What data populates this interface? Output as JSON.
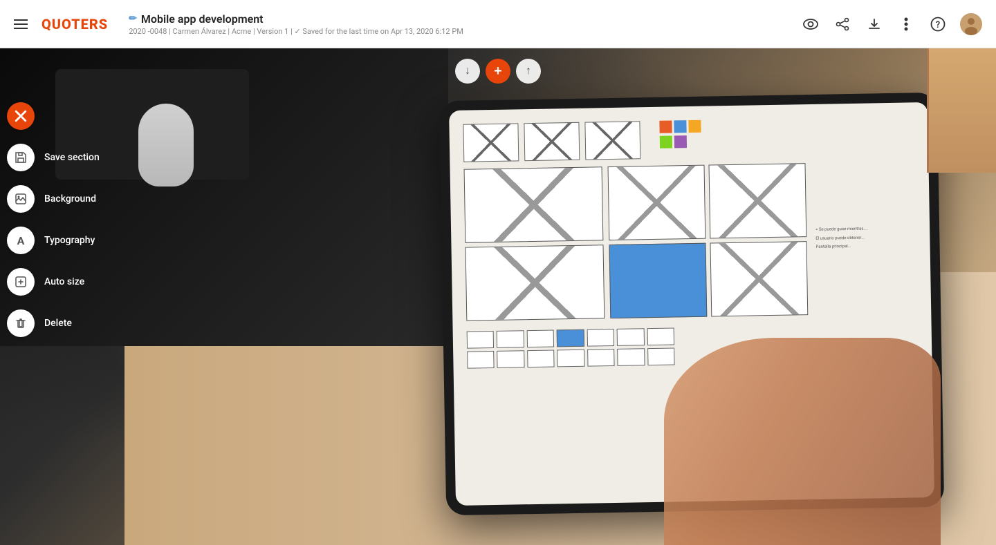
{
  "header": {
    "logo": "QUOTERS",
    "project": {
      "title": "Mobile app development",
      "meta": "2020 -0048 | Carmen Álvarez | Acme |  Version 1 | ✓ Saved for the last time on Apr 13, 2020 6:12 PM",
      "edit_icon": "✏"
    },
    "icons": {
      "eye": "👁",
      "share": "⬆",
      "download": "⬇",
      "more": "⋮",
      "help": "?"
    }
  },
  "toolbar": {
    "down_label": "↓",
    "add_label": "+",
    "up_label": "↑"
  },
  "side_menu": {
    "close_icon": "×",
    "items": [
      {
        "id": "save-section",
        "label": "Save section",
        "icon": "bookmark"
      },
      {
        "id": "background",
        "label": "Background",
        "icon": "image"
      },
      {
        "id": "typography",
        "label": "Typography",
        "icon": "A"
      },
      {
        "id": "auto-size",
        "label": "Auto size",
        "icon": "resize"
      },
      {
        "id": "delete",
        "label": "Delete",
        "icon": "trash"
      }
    ]
  },
  "colors": {
    "brand_red": "#e8450a",
    "header_bg": "#ffffff",
    "menu_item_bg": "#ffffff",
    "label_color": "#ffffff"
  }
}
